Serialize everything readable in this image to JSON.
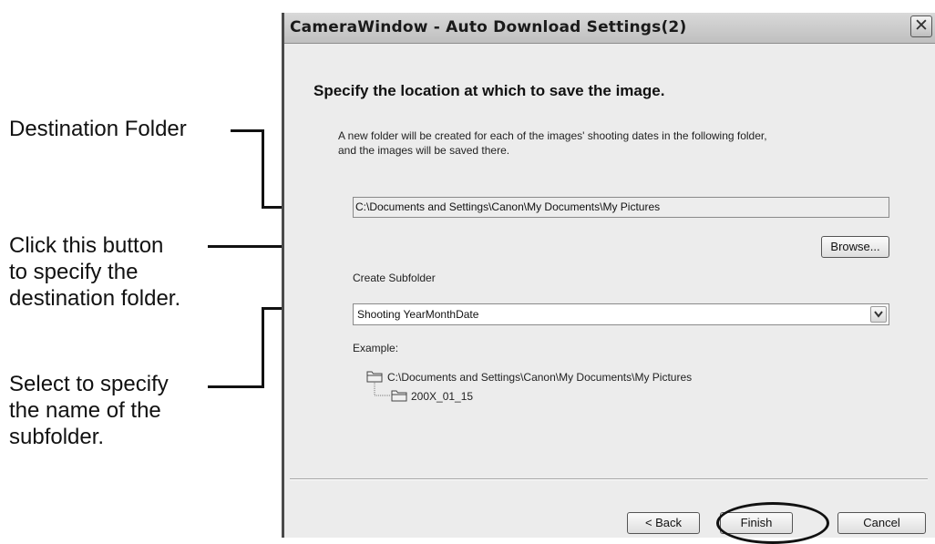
{
  "annotations": {
    "destination_folder": "Destination Folder",
    "browse_hint": [
      "Click this button",
      "to specify the",
      "destination folder."
    ],
    "subfolder_hint": [
      "Select to specify",
      "the name of the",
      "subfolder."
    ]
  },
  "dialog": {
    "title": "CameraWindow - Auto Download Settings(2)",
    "close_glyph": "✕",
    "heading": "Specify the location at which to save the image.",
    "description": [
      "A new folder will be created for each of the images' shooting dates in the following folder,",
      "and the images will be saved there."
    ],
    "destination_path": "C:\\Documents and Settings\\Canon\\My Documents\\My Pictures",
    "browse_label": "Browse...",
    "subfolder_label": "Create Subfolder",
    "subfolder_value": "Shooting YearMonthDate",
    "example_label": "Example:",
    "example_tree": {
      "root": "C:\\Documents and Settings\\Canon\\My Documents\\My Pictures",
      "child": "200X_01_15"
    },
    "buttons": {
      "back": "< Back",
      "finish": "Finish",
      "cancel": "Cancel"
    }
  },
  "icons": {
    "folder": "folder-icon",
    "dropdown": "chevron-down-icon",
    "close": "close-icon"
  }
}
